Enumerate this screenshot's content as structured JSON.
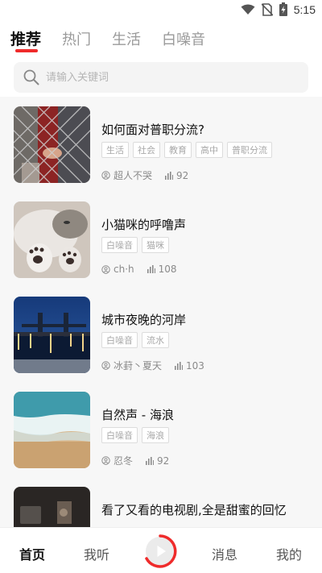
{
  "status_bar": {
    "time": "5:15",
    "icons": [
      "wifi-icon",
      "no-sim-icon",
      "battery-charging-icon"
    ]
  },
  "tabs": [
    {
      "label": "推荐",
      "active": true
    },
    {
      "label": "热门"
    },
    {
      "label": "生活"
    },
    {
      "label": "白噪音"
    }
  ],
  "search": {
    "placeholder": "请输入关键词",
    "icon": "search-icon"
  },
  "items": [
    {
      "title": "如何面对普职分流?",
      "tags": [
        "生活",
        "社会",
        "教育",
        "高中",
        "普职分流"
      ],
      "author": "超人不哭",
      "plays": "92"
    },
    {
      "title": "小猫咪的呼噜声",
      "tags": [
        "白噪音",
        "猫咪"
      ],
      "author": "ch·h",
      "plays": "108"
    },
    {
      "title": "城市夜晚的河岸",
      "tags": [
        "白噪音",
        "流水"
      ],
      "author": "冰葑丶夏天",
      "plays": "103"
    },
    {
      "title": "自然声 - 海浪",
      "tags": [
        "白噪音",
        "海浪"
      ],
      "author": "忍冬",
      "plays": "92"
    },
    {
      "title": "看了又看的电视剧,全是甜蜜的回忆",
      "tags": [],
      "author": "",
      "plays": ""
    }
  ],
  "bottom_nav": {
    "home": "首页",
    "listen": "我听",
    "messages": "消息",
    "mine": "我的"
  },
  "colors": {
    "accent": "#ef2b2b",
    "list_bg": "#f7f7f7"
  }
}
